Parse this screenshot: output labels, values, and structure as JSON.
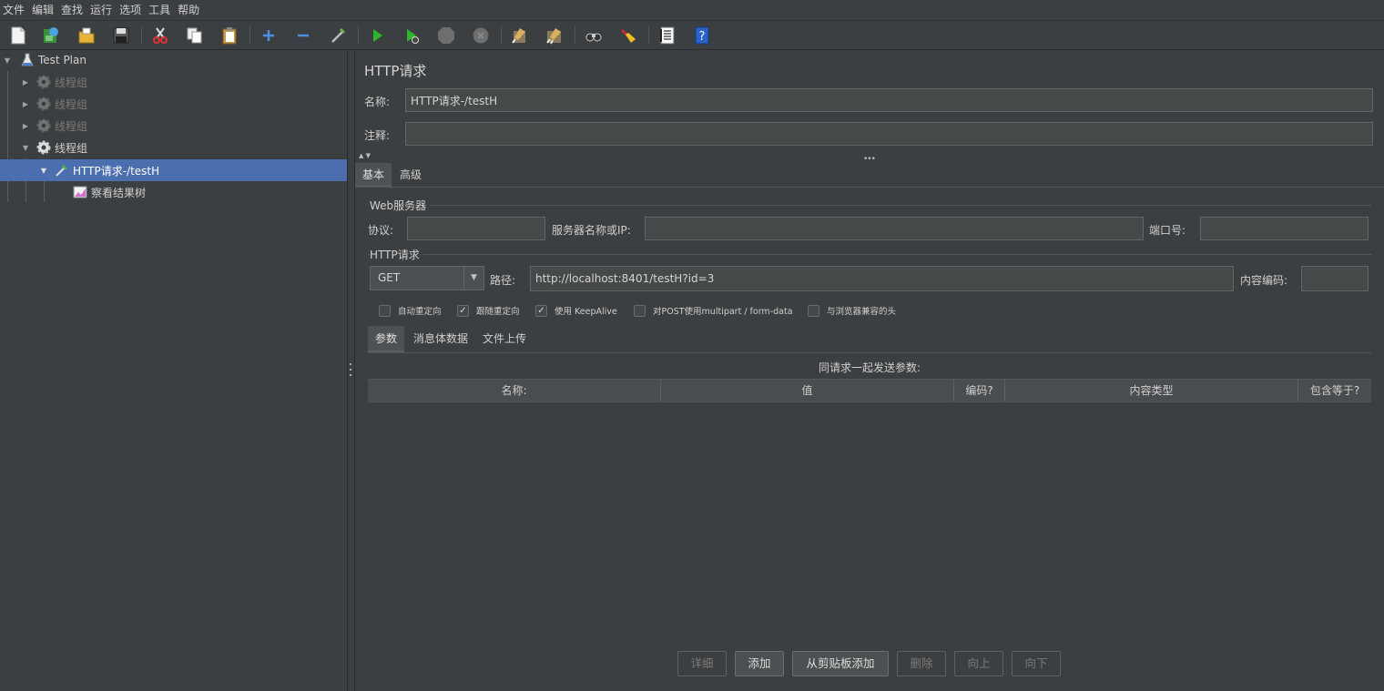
{
  "menu": [
    "文件",
    "编辑",
    "查找",
    "运行",
    "选项",
    "工具",
    "帮助"
  ],
  "toolbar": {
    "icons": [
      "new-icon",
      "templates-icon",
      "open-icon",
      "save-icon",
      "cut-icon",
      "copy-icon",
      "paste-icon",
      "expand-icon",
      "collapse-icon",
      "toggle-icon",
      "start-icon",
      "start-no-pause-icon",
      "stop-icon",
      "shutdown-icon",
      "clear-icon",
      "clear-all-icon",
      "search-icon",
      "reset-search-icon",
      "function-helper-icon",
      "help-icon"
    ]
  },
  "tree": {
    "root": "Test Plan",
    "thread_groups": [
      "线程组",
      "线程组",
      "线程组",
      "线程组"
    ],
    "sampler": "HTTP请求-/testH",
    "listener": "察看结果树"
  },
  "panel": {
    "title": "HTTP请求",
    "name_label": "名称:",
    "name_value": "HTTP请求-/testH",
    "comment_label": "注释:",
    "comment_value": "",
    "tabs": [
      "基本",
      "高级"
    ],
    "web_server": {
      "title": "Web服务器",
      "protocol_label": "协议:",
      "protocol_value": "",
      "server_label": "服务器名称或IP:",
      "server_value": "",
      "port_label": "端口号:",
      "port_value": ""
    },
    "http_request": {
      "title": "HTTP请求",
      "method": "GET",
      "path_label": "路径:",
      "path_value": "http://localhost:8401/testH?id=3",
      "encoding_label": "内容编码:",
      "encoding_value": ""
    },
    "checkboxes": [
      {
        "label": "自动重定向",
        "checked": false
      },
      {
        "label": "跟随重定向",
        "checked": true
      },
      {
        "label": "使用 KeepAlive",
        "checked": true
      },
      {
        "label": "对POST使用multipart / form-data",
        "checked": false
      },
      {
        "label": "与浏览器兼容的头",
        "checked": false
      }
    ],
    "sub_tabs": [
      "参数",
      "消息体数据",
      "文件上传"
    ],
    "table_caption": "同请求一起发送参数:",
    "columns": [
      "名称:",
      "值",
      "编码?",
      "内容类型",
      "包含等于?"
    ],
    "buttons": [
      "详细",
      "添加",
      "从剪贴板添加",
      "删除",
      "向上",
      "向下"
    ]
  },
  "colors": {
    "background": "#3c3f41",
    "selection": "#4b6eaf",
    "field": "#45494a"
  }
}
